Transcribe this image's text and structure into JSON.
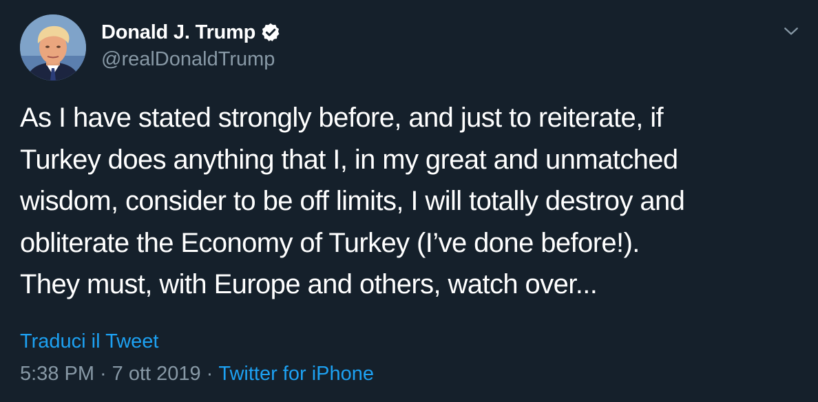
{
  "author": {
    "display_name": "Donald J. Trump",
    "handle": "@realDonaldTrump",
    "verified": true,
    "avatar_icon": "profile-photo"
  },
  "tweet": {
    "text": "As I have stated strongly before, and just to reiterate, if\nTurkey does anything that I, in my great and unmatched\nwisdom, consider to be off limits, I will totally destroy and\nobliterate the Economy of Turkey (I’ve done before!).\nThey must, with Europe and others, watch over...",
    "translate_label": "Traduci il Tweet",
    "time": "5:38 PM",
    "date": "7 ott 2019",
    "separator": "·",
    "source": "Twitter for iPhone"
  },
  "menu": {
    "icon": "chevron-down-icon"
  },
  "colors": {
    "background": "#15202b",
    "text": "#ffffff",
    "secondary_text": "#8899a6",
    "accent": "#1da1f2"
  }
}
